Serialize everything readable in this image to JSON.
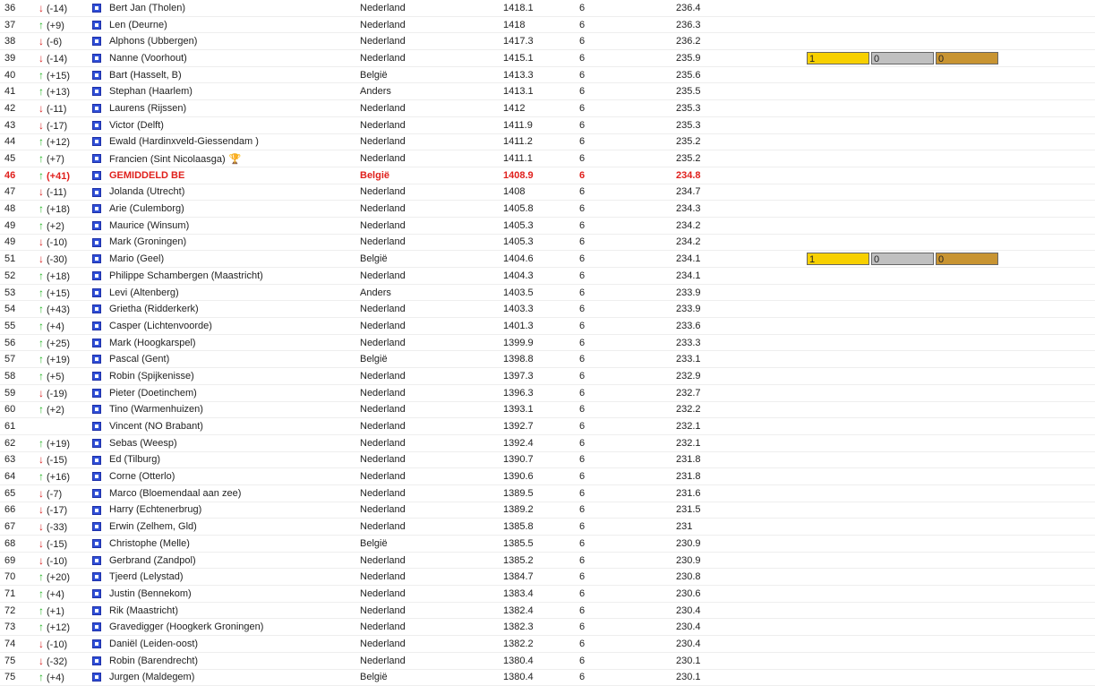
{
  "colors": {
    "up": "#22b522",
    "down": "#d82020",
    "highlight": "#e0201c",
    "gold": "#f7d000",
    "silver": "#c0c0c0",
    "bronze": "#c89432"
  },
  "rows": [
    {
      "rank": "36",
      "dir": "down",
      "change": "(-14)",
      "name": "Bert Jan (Tholen)",
      "country": "Nederland",
      "score": "1418.1",
      "games": "6",
      "avg": "236.4"
    },
    {
      "rank": "37",
      "dir": "up",
      "change": "(+9)",
      "name": "Len (Deurne)",
      "country": "Nederland",
      "score": "1418",
      "games": "6",
      "avg": "236.3"
    },
    {
      "rank": "38",
      "dir": "down",
      "change": "(-6)",
      "name": "Alphons (Ubbergen)",
      "country": "Nederland",
      "score": "1417.3",
      "games": "6",
      "avg": "236.2"
    },
    {
      "rank": "39",
      "dir": "down",
      "change": "(-14)",
      "name": "Nanne (Voorhout)",
      "country": "Nederland",
      "score": "1415.1",
      "games": "6",
      "avg": "235.9",
      "medals": [
        "1",
        "0",
        "0"
      ]
    },
    {
      "rank": "40",
      "dir": "up",
      "change": "(+15)",
      "name": "Bart (Hasselt, B)",
      "country": "België",
      "score": "1413.3",
      "games": "6",
      "avg": "235.6"
    },
    {
      "rank": "41",
      "dir": "up",
      "change": "(+13)",
      "name": "Stephan (Haarlem)",
      "country": "Anders",
      "score": "1413.1",
      "games": "6",
      "avg": "235.5"
    },
    {
      "rank": "42",
      "dir": "down",
      "change": "(-11)",
      "name": "Laurens (Rijssen)",
      "country": "Nederland",
      "score": "1412",
      "games": "6",
      "avg": "235.3"
    },
    {
      "rank": "43",
      "dir": "down",
      "change": "(-17)",
      "name": "Victor (Delft)",
      "country": "Nederland",
      "score": "1411.9",
      "games": "6",
      "avg": "235.3"
    },
    {
      "rank": "44",
      "dir": "up",
      "change": "(+12)",
      "name": "Ewald (Hardinxveld-Giessendam )",
      "country": "Nederland",
      "score": "1411.2",
      "games": "6",
      "avg": "235.2"
    },
    {
      "rank": "45",
      "dir": "up",
      "change": "(+7)",
      "name": "Francien (Sint Nicolaasga)",
      "country": "Nederland",
      "score": "1411.1",
      "games": "6",
      "avg": "235.2",
      "trophy": true
    },
    {
      "rank": "46",
      "dir": "up",
      "change": "(+41)",
      "name": "GEMIDDELD BE",
      "country": "België",
      "score": "1408.9",
      "games": "6",
      "avg": "234.8",
      "highlight": true
    },
    {
      "rank": "47",
      "dir": "down",
      "change": "(-11)",
      "name": "Jolanda (Utrecht)",
      "country": "Nederland",
      "score": "1408",
      "games": "6",
      "avg": "234.7"
    },
    {
      "rank": "48",
      "dir": "up",
      "change": "(+18)",
      "name": "Arie (Culemborg)",
      "country": "Nederland",
      "score": "1405.8",
      "games": "6",
      "avg": "234.3"
    },
    {
      "rank": "49",
      "dir": "up",
      "change": "(+2)",
      "name": "Maurice (Winsum)",
      "country": "Nederland",
      "score": "1405.3",
      "games": "6",
      "avg": "234.2"
    },
    {
      "rank": "49",
      "dir": "down",
      "change": "(-10)",
      "name": "Mark (Groningen)",
      "country": "Nederland",
      "score": "1405.3",
      "games": "6",
      "avg": "234.2"
    },
    {
      "rank": "51",
      "dir": "down",
      "change": "(-30)",
      "name": "Mario (Geel)",
      "country": "België",
      "score": "1404.6",
      "games": "6",
      "avg": "234.1",
      "medals": [
        "1",
        "0",
        "0"
      ]
    },
    {
      "rank": "52",
      "dir": "up",
      "change": "(+18)",
      "name": "Philippe Schambergen (Maastricht)",
      "country": "Nederland",
      "score": "1404.3",
      "games": "6",
      "avg": "234.1"
    },
    {
      "rank": "53",
      "dir": "up",
      "change": "(+15)",
      "name": "Levi (Altenberg)",
      "country": "Anders",
      "score": "1403.5",
      "games": "6",
      "avg": "233.9"
    },
    {
      "rank": "54",
      "dir": "up",
      "change": "(+43)",
      "name": "Grietha (Ridderkerk)",
      "country": "Nederland",
      "score": "1403.3",
      "games": "6",
      "avg": "233.9"
    },
    {
      "rank": "55",
      "dir": "up",
      "change": "(+4)",
      "name": "Casper (Lichtenvoorde)",
      "country": "Nederland",
      "score": "1401.3",
      "games": "6",
      "avg": "233.6"
    },
    {
      "rank": "56",
      "dir": "up",
      "change": "(+25)",
      "name": "Mark (Hoogkarspel)",
      "country": "Nederland",
      "score": "1399.9",
      "games": "6",
      "avg": "233.3"
    },
    {
      "rank": "57",
      "dir": "up",
      "change": "(+19)",
      "name": "Pascal (Gent)",
      "country": "België",
      "score": "1398.8",
      "games": "6",
      "avg": "233.1"
    },
    {
      "rank": "58",
      "dir": "up",
      "change": "(+5)",
      "name": "Robin (Spijkenisse)",
      "country": "Nederland",
      "score": "1397.3",
      "games": "6",
      "avg": "232.9"
    },
    {
      "rank": "59",
      "dir": "down",
      "change": "(-19)",
      "name": "Pieter (Doetinchem)",
      "country": "Nederland",
      "score": "1396.3",
      "games": "6",
      "avg": "232.7"
    },
    {
      "rank": "60",
      "dir": "up",
      "change": "(+2)",
      "name": "Tino (Warmenhuizen)",
      "country": "Nederland",
      "score": "1393.1",
      "games": "6",
      "avg": "232.2"
    },
    {
      "rank": "61",
      "dir": "",
      "change": "",
      "name": "Vincent (NO Brabant)",
      "country": "Nederland",
      "score": "1392.7",
      "games": "6",
      "avg": "232.1"
    },
    {
      "rank": "62",
      "dir": "up",
      "change": "(+19)",
      "name": "Sebas (Weesp)",
      "country": "Nederland",
      "score": "1392.4",
      "games": "6",
      "avg": "232.1"
    },
    {
      "rank": "63",
      "dir": "down",
      "change": "(-15)",
      "name": "Ed (Tilburg)",
      "country": "Nederland",
      "score": "1390.7",
      "games": "6",
      "avg": "231.8"
    },
    {
      "rank": "64",
      "dir": "up",
      "change": "(+16)",
      "name": "Corne (Otterlo)",
      "country": "Nederland",
      "score": "1390.6",
      "games": "6",
      "avg": "231.8"
    },
    {
      "rank": "65",
      "dir": "down",
      "change": "(-7)",
      "name": "Marco (Bloemendaal aan zee)",
      "country": "Nederland",
      "score": "1389.5",
      "games": "6",
      "avg": "231.6"
    },
    {
      "rank": "66",
      "dir": "down",
      "change": "(-17)",
      "name": "Harry (Echtenerbrug)",
      "country": "Nederland",
      "score": "1389.2",
      "games": "6",
      "avg": "231.5"
    },
    {
      "rank": "67",
      "dir": "down",
      "change": "(-33)",
      "name": "Erwin (Zelhem, Gld)",
      "country": "Nederland",
      "score": "1385.8",
      "games": "6",
      "avg": "231"
    },
    {
      "rank": "68",
      "dir": "down",
      "change": "(-15)",
      "name": "Christophe (Melle)",
      "country": "België",
      "score": "1385.5",
      "games": "6",
      "avg": "230.9"
    },
    {
      "rank": "69",
      "dir": "down",
      "change": "(-10)",
      "name": "Gerbrand (Zandpol)",
      "country": "Nederland",
      "score": "1385.2",
      "games": "6",
      "avg": "230.9"
    },
    {
      "rank": "70",
      "dir": "up",
      "change": "(+20)",
      "name": "Tjeerd (Lelystad)",
      "country": "Nederland",
      "score": "1384.7",
      "games": "6",
      "avg": "230.8"
    },
    {
      "rank": "71",
      "dir": "up",
      "change": "(+4)",
      "name": "Justin (Bennekom)",
      "country": "Nederland",
      "score": "1383.4",
      "games": "6",
      "avg": "230.6"
    },
    {
      "rank": "72",
      "dir": "up",
      "change": "(+1)",
      "name": "Rik (Maastricht)",
      "country": "Nederland",
      "score": "1382.4",
      "games": "6",
      "avg": "230.4"
    },
    {
      "rank": "73",
      "dir": "up",
      "change": "(+12)",
      "name": "Gravedigger (Hoogkerk Groningen)",
      "country": "Nederland",
      "score": "1382.3",
      "games": "6",
      "avg": "230.4"
    },
    {
      "rank": "74",
      "dir": "down",
      "change": "(-10)",
      "name": "Daniël (Leiden-oost)",
      "country": "Nederland",
      "score": "1382.2",
      "games": "6",
      "avg": "230.4"
    },
    {
      "rank": "75",
      "dir": "down",
      "change": "(-32)",
      "name": "Robin (Barendrecht)",
      "country": "Nederland",
      "score": "1380.4",
      "games": "6",
      "avg": "230.1"
    },
    {
      "rank": "75",
      "dir": "up",
      "change": "(+4)",
      "name": "Jurgen (Maldegem)",
      "country": "België",
      "score": "1380.4",
      "games": "6",
      "avg": "230.1"
    }
  ]
}
